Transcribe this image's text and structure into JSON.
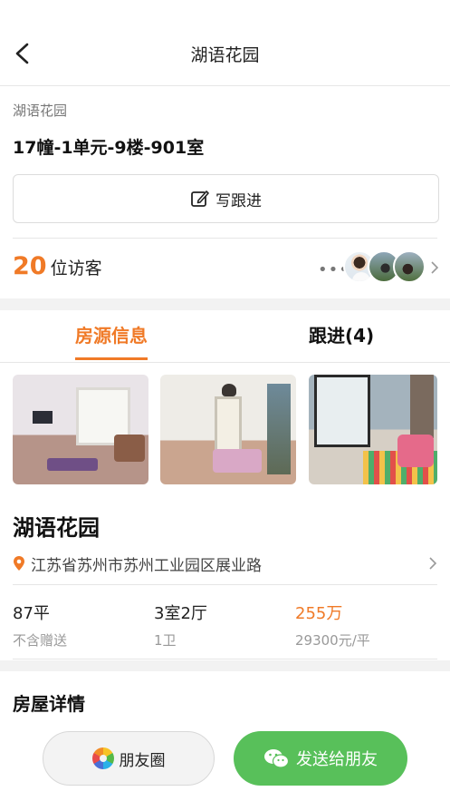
{
  "nav": {
    "title": "湖语花园"
  },
  "house": {
    "community": "湖语花园",
    "unit": "17幢-1单元-9楼-901室",
    "follow_button": "写跟进"
  },
  "visitors": {
    "count": "20",
    "label": "位访客",
    "more": "•••"
  },
  "tabs": [
    {
      "label": "房源信息",
      "active": true
    },
    {
      "label": "跟进(4)",
      "active": false
    }
  ],
  "listing": {
    "name": "湖语花园",
    "address": "江苏省苏州市苏州工业园区展业路",
    "stats": [
      {
        "value": "87平",
        "sub": "不含赠送"
      },
      {
        "value": "3室2厅",
        "sub": "1卫"
      },
      {
        "value": "255万",
        "sub": "29300元/平"
      }
    ]
  },
  "sections": {
    "details_title": "房屋详情"
  },
  "bottom": {
    "moments_label": "朋友圈",
    "wechat_label": "发送给朋友"
  },
  "colors": {
    "accent": "#f07a27",
    "wechat_green": "#58c05a"
  },
  "icons": [
    "back-arrow-icon",
    "edit-icon",
    "chevron-right-icon",
    "location-pin-icon",
    "moments-icon",
    "wechat-icon"
  ]
}
